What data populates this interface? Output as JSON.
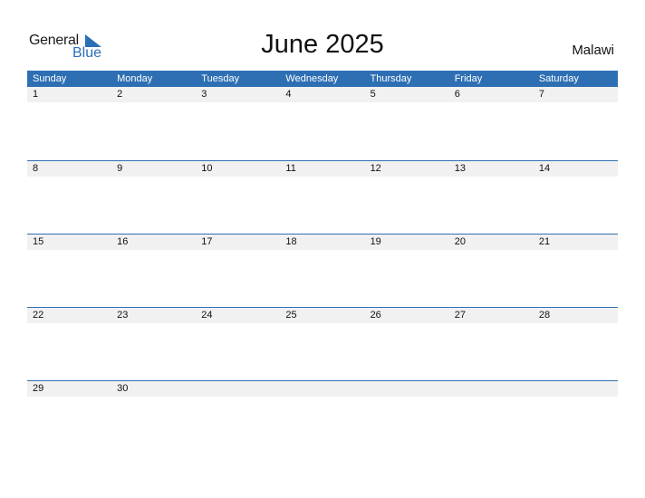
{
  "logo": {
    "word1": "General",
    "word2": "Blue"
  },
  "title": "June 2025",
  "country": "Malawi",
  "colors": {
    "accent": "#2e6fb3",
    "strip": "#f1f1f1"
  },
  "weekdays": [
    "Sunday",
    "Monday",
    "Tuesday",
    "Wednesday",
    "Thursday",
    "Friday",
    "Saturday"
  ],
  "weeks": [
    [
      "1",
      "2",
      "3",
      "4",
      "5",
      "6",
      "7"
    ],
    [
      "8",
      "9",
      "10",
      "11",
      "12",
      "13",
      "14"
    ],
    [
      "15",
      "16",
      "17",
      "18",
      "19",
      "20",
      "21"
    ],
    [
      "22",
      "23",
      "24",
      "25",
      "26",
      "27",
      "28"
    ],
    [
      "29",
      "30",
      "",
      "",
      "",
      "",
      ""
    ]
  ]
}
